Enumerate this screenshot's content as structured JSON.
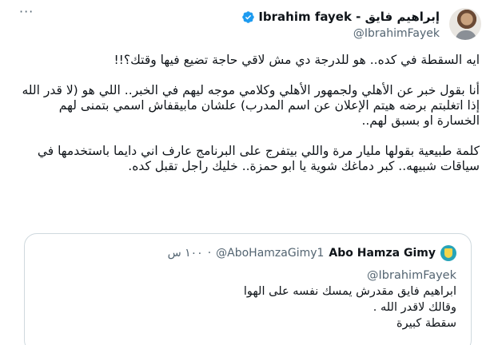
{
  "author": {
    "display_name": "إبراهيم فايق - Ibrahim fayek",
    "handle": "@IbrahimFayek",
    "verified": true
  },
  "more_label": "···",
  "tweet_paragraphs": [
    "ايه السقطة في كده.. هو للدرجة دي مش لاقي حاجة تضيع فيها وقتك؟!!",
    "أنا بقول خبر عن الأهلي ولجمهور الأهلي وكلامي موجه ليهم في الخبر.. اللي هو (لا قدر الله إذا اتغلبتم برضه هيتم الإعلان عن اسم المدرب) علشان مابيقفاش اسمي بتمنى لهم الخسارة او بسبق لهم..",
    "كلمة طبيعية بقولها مليار مرة واللي بيتفرج على البرنامج عارف اني دايما باستخدمها في سياقات شبيهه.. كبر دماغك شوية يا ابو حمزة.. خليك راجل تقبل كده."
  ],
  "quoted_tweet": {
    "name": "Abo Hamza Gimy",
    "handle": "@AboHamzaGimy1",
    "separator": "·",
    "time": "١٠٠ س",
    "replying_to": "@IbrahimFayek",
    "lines": [
      "ابراهيم فايق مقدرش يمسك نفسه على الهوا",
      "وقالك لاقدر الله .",
      "سقطة كبيرة"
    ]
  },
  "colors": {
    "verified_blue": "#1d9bf0",
    "secondary_text": "#536471",
    "border": "#cfd9de"
  }
}
